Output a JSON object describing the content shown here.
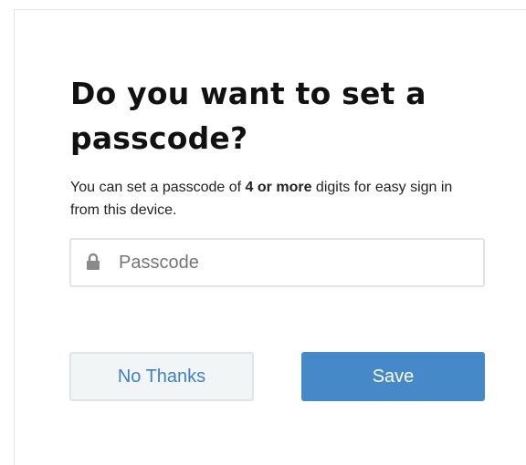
{
  "dialog": {
    "title": "Do you want to set a passcode?",
    "description": {
      "before": "You can set a passcode of ",
      "bold": "4 or more",
      "after": " digits for easy sign in from this device."
    },
    "passcode_field": {
      "placeholder": "Passcode",
      "value": "",
      "icon": "lock-icon"
    },
    "buttons": {
      "no_thanks_label": "No Thanks",
      "save_label": "Save"
    }
  },
  "colors": {
    "primary": "#4589c8",
    "secondary_text": "#3f80bf",
    "secondary_bg": "#f2f5f6",
    "border": "#e3e3e3",
    "title_text": "#111111"
  }
}
